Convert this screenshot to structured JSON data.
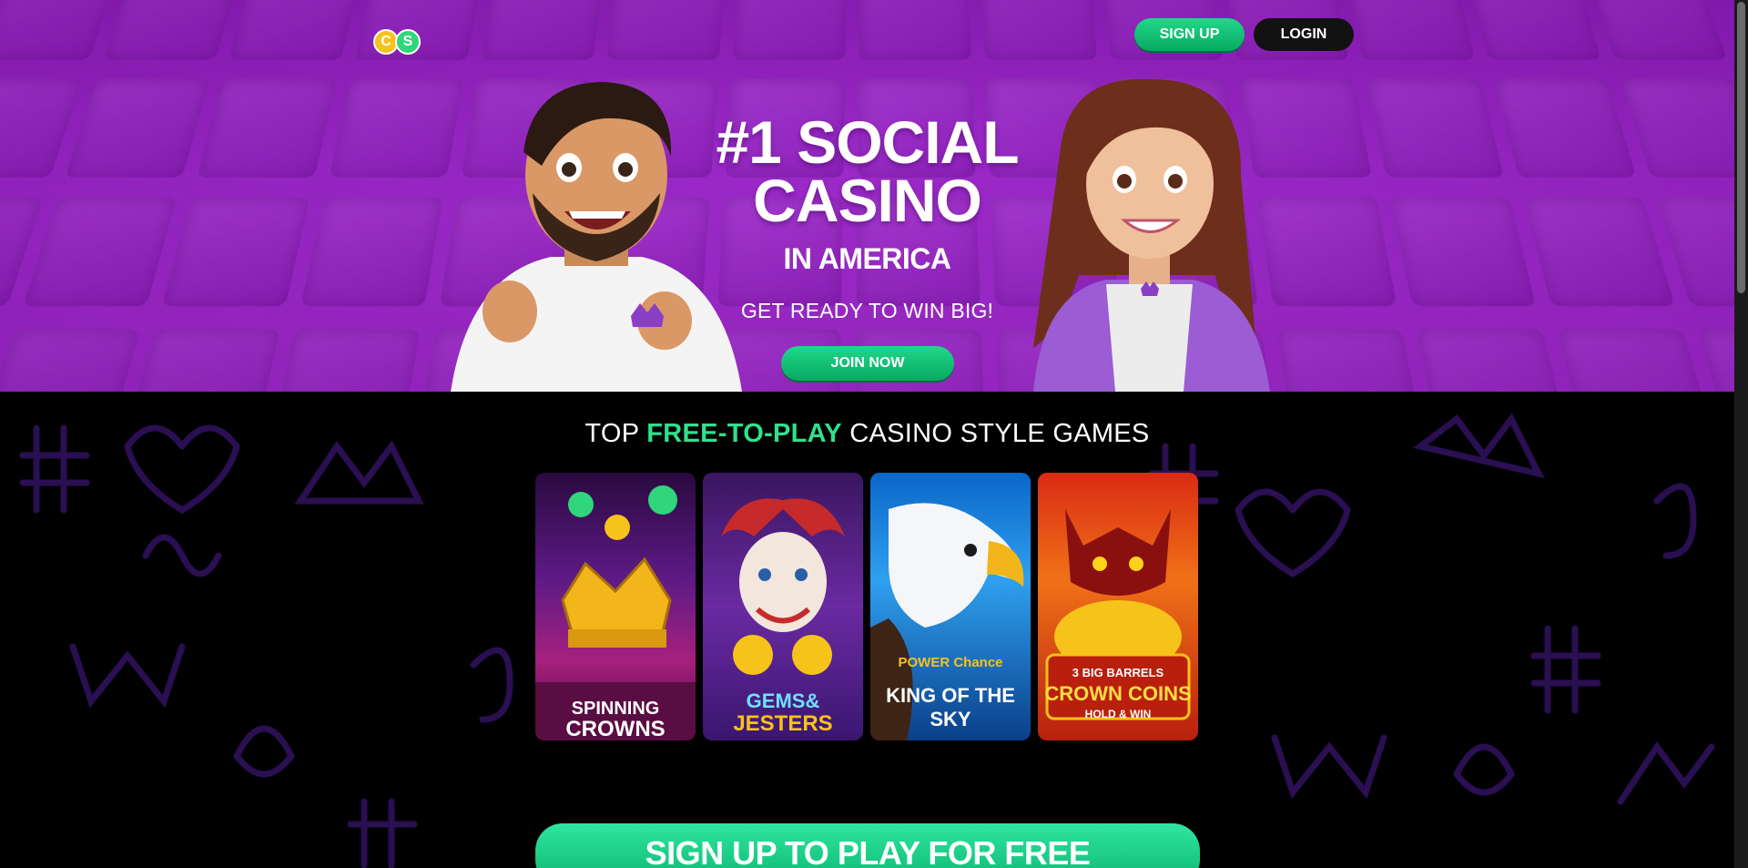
{
  "header": {
    "logo_text": "CS",
    "signup_label": "SIGN UP",
    "login_label": "LOGIN"
  },
  "hero": {
    "title_line1": "#1 SOCIAL",
    "title_line2": "CASINO",
    "subtitle": "IN AMERICA",
    "tagline": "GET READY TO WIN BIG!",
    "join_label": "JOIN NOW"
  },
  "games_section": {
    "title_pre": "TOP",
    "title_highlight": "FREE-TO-PLAY",
    "title_post": "CASINO STYLE GAMES",
    "games": [
      {
        "line1": "SPINNING",
        "line2": "CROWNS"
      },
      {
        "line1": "GEMS&",
        "line2": "JESTERS"
      },
      {
        "line1": "POWER Chance",
        "line2": "KING OF THE SKY"
      },
      {
        "line1": "3 BIG BARRELS",
        "line2": "CROWN COINS",
        "line3": "HOLD & WIN"
      }
    ],
    "cta_label": "SIGN UP TO PLAY FOR FREE"
  },
  "colors": {
    "accent_green": "#2fe08c",
    "hero_purple": "#9b2bc7",
    "background": "#000000"
  }
}
